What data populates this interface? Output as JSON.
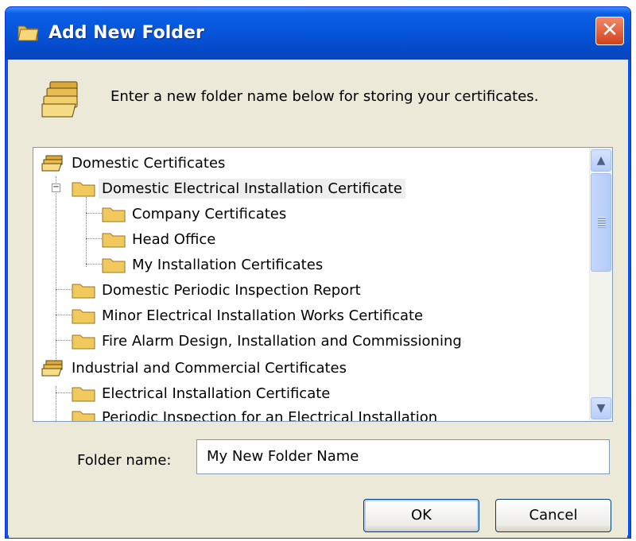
{
  "window": {
    "title": "Add New Folder",
    "close_label": "✕"
  },
  "header": {
    "text": "Enter a new folder name below for storing your certificates."
  },
  "tree": {
    "items": [
      {
        "label": "Domestic Certificates"
      },
      {
        "label": "Domestic Electrical Installation Certificate"
      },
      {
        "label": "Company Certificates"
      },
      {
        "label": "Head Office"
      },
      {
        "label": "My Installation Certificates"
      },
      {
        "label": "Domestic Periodic Inspection Report"
      },
      {
        "label": "Minor Electrical Installation Works Certificate"
      },
      {
        "label": "Fire Alarm Design, Installation and Commissioning"
      },
      {
        "label": "Industrial and Commercial Certificates"
      },
      {
        "label": "Electrical Installation Certificate"
      },
      {
        "label": "Periodic Inspection for an Electrical Installation"
      }
    ],
    "scroll_up": "▲",
    "scroll_down": "▼"
  },
  "form": {
    "folder_name_label": "Folder name:",
    "folder_name_value": "My New Folder Name"
  },
  "buttons": {
    "ok": "OK",
    "cancel": "Cancel"
  }
}
